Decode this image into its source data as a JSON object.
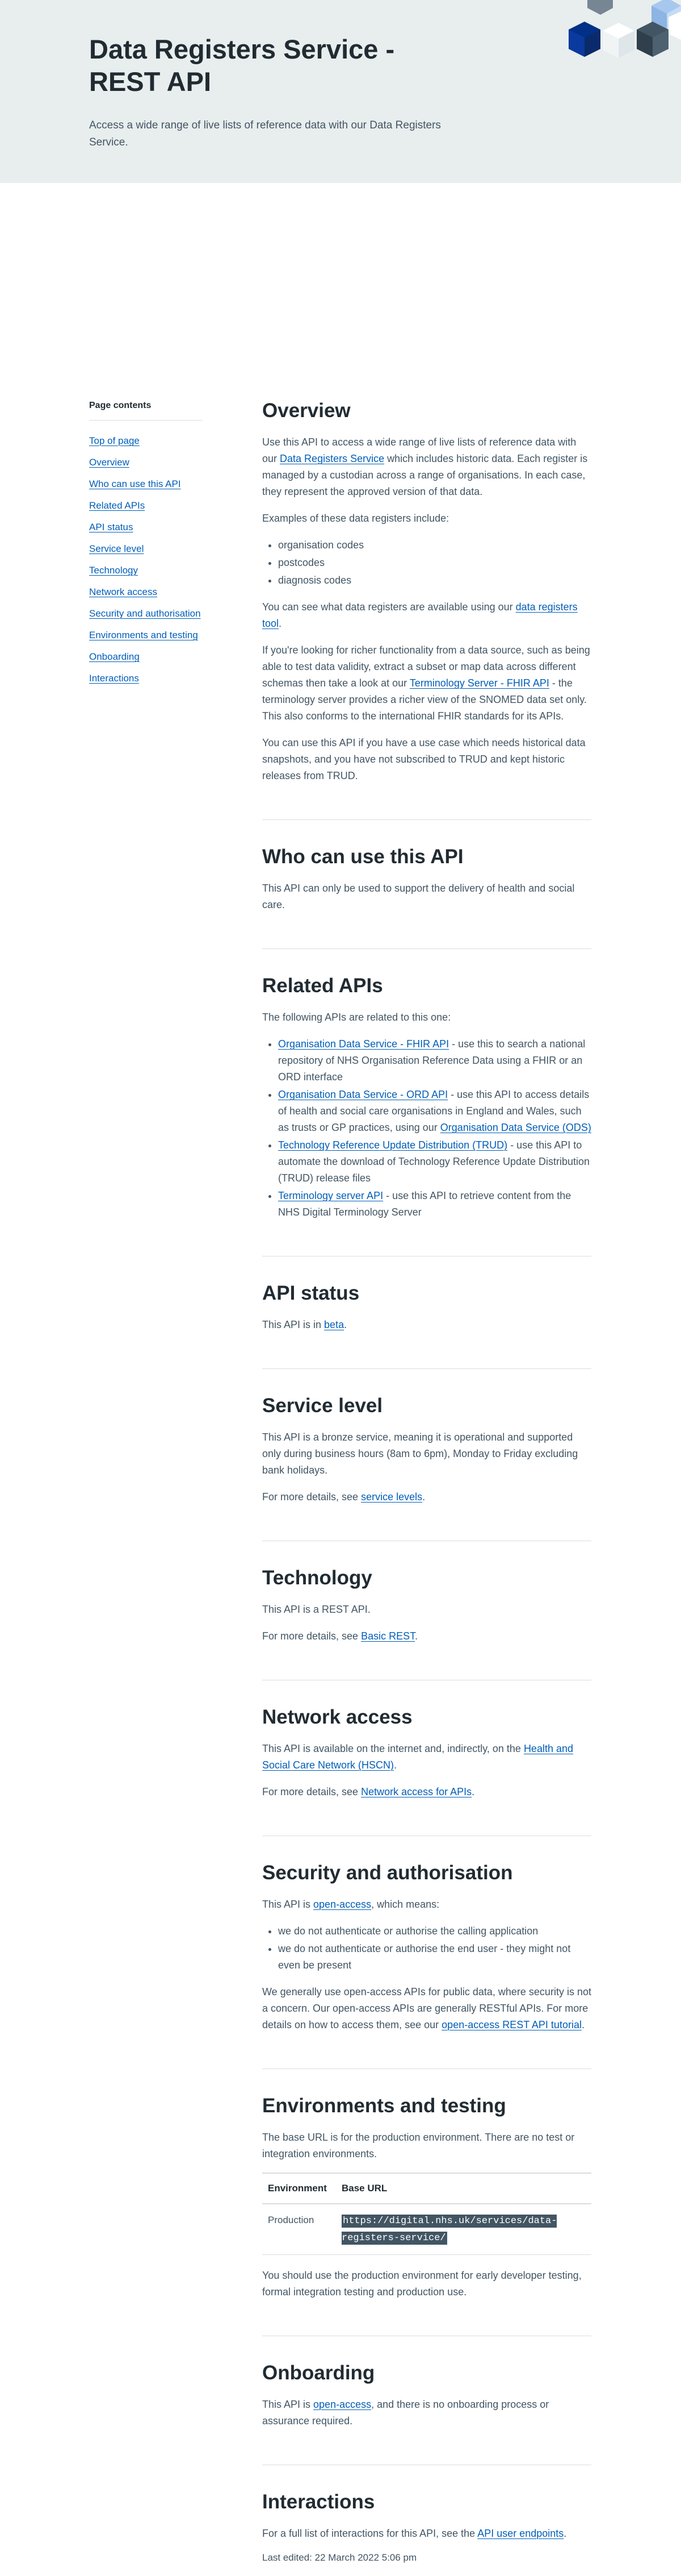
{
  "hero": {
    "title": "Data Registers Service - REST API",
    "summary": "Access a wide range of live lists of reference data with our Data Registers Service."
  },
  "nav": {
    "title": "Page contents",
    "items": [
      {
        "label": "Top of page"
      },
      {
        "label": "Overview"
      },
      {
        "label": "Who can use this API"
      },
      {
        "label": "Related APIs"
      },
      {
        "label": "API status"
      },
      {
        "label": "Service level"
      },
      {
        "label": "Technology"
      },
      {
        "label": "Network access"
      },
      {
        "label": "Security and authorisation"
      },
      {
        "label": "Environments and testing"
      },
      {
        "label": "Onboarding"
      },
      {
        "label": "Interactions"
      }
    ]
  },
  "overview": {
    "heading": "Overview",
    "p1_a": "Use this API to access a wide range of live lists of reference data with our ",
    "p1_link": "Data Registers Service",
    "p1_b": " which includes historic data. Each register is managed by a custodian across a range of organisations. In each case, they represent the approved version of that data.",
    "p2": "Examples of these data registers include:",
    "examples": [
      "organisation codes",
      "postcodes",
      "diagnosis codes"
    ],
    "p3_a": "You can see what data registers are available using our ",
    "p3_link": "data registers tool",
    "p3_b": ".",
    "p4_a": "If you're looking for richer functionality from a data source, such as being able to test data validity, extract a subset or map data across different schemas then take a look at our ",
    "p4_link": "Terminology Server - FHIR API",
    "p4_b": " - the terminology server provides a richer view of the SNOMED data set only. This also conforms to the international FHIR standards for its APIs.",
    "p5": "You can use this API if you have a use case which needs historical data snapshots, and you have not subscribed to TRUD and kept historic releases from TRUD."
  },
  "who": {
    "heading": "Who can use this API",
    "p1": "This API can only be used to support the delivery of health and social care."
  },
  "related": {
    "heading": "Related APIs",
    "intro": "The following APIs are related to this one:",
    "items": [
      {
        "link": "Organisation Data Service - FHIR API",
        "text": " - use this to search a national repository of NHS Organisation Reference Data using a FHIR or an ORD interface"
      },
      {
        "link": "Organisation Data Service - ORD API",
        "text": " - use this API to access details of health and social care organisations in England and Wales, such as trusts or GP practices, using our ",
        "link2": "Organisation Data Service (ODS)"
      },
      {
        "link": "Technology Reference Update Distribution (TRUD)",
        "text": " - use this API to automate the download of Technology Reference Update Distribution (TRUD) release files"
      },
      {
        "link": "Terminology server API",
        "text": " - use this API to retrieve content from the NHS Digital Terminology Server"
      }
    ]
  },
  "status": {
    "heading": "API status",
    "p1_a": "This API is in ",
    "p1_link": "beta",
    "p1_b": "."
  },
  "service_level": {
    "heading": "Service level",
    "p1": "This API is a bronze service, meaning it is operational and supported only during business hours (8am to 6pm), Monday to Friday excluding bank holidays.",
    "p2_a": "For more details, see ",
    "p2_link": "service levels",
    "p2_b": "."
  },
  "technology": {
    "heading": "Technology",
    "p1": "This API is a REST API.",
    "p2_a": "For more details, see ",
    "p2_link": "Basic REST",
    "p2_b": "."
  },
  "network": {
    "heading": "Network access",
    "p1_a": "This API is available on the internet and, indirectly, on the ",
    "p1_link": "Health and Social Care Network (HSCN)",
    "p1_b": ".",
    "p2_a": "For more details, see ",
    "p2_link": "Network access for APIs",
    "p2_b": "."
  },
  "security": {
    "heading": "Security and authorisation",
    "p1_a": "This API is ",
    "p1_link": "open-access",
    "p1_b": ", which means:",
    "points": [
      "we do not authenticate or authorise the calling application",
      "we do not authenticate or authorise the end user - they might not even be present"
    ],
    "p2_a": "We generally use open-access APIs for public data, where security is not a concern. Our open-access APIs are generally RESTful APIs. For more details on how to access them, see our ",
    "p2_link": "open-access REST API tutorial",
    "p2_b": "."
  },
  "environments": {
    "heading": "Environments and testing",
    "p1": "The base URL is for the production environment.  There are no test or integration environments.",
    "col_env": "Environment",
    "col_url": "Base URL",
    "rows": [
      {
        "env": "Production",
        "url": "https://digital.nhs.uk/services/data-registers-service/"
      }
    ],
    "p2": "You should use the production environment for early developer testing, formal integration testing and production use."
  },
  "onboarding": {
    "heading": "Onboarding",
    "p1_a": "This API is ",
    "p1_link": "open-access",
    "p1_b": ", and there is no onboarding process or assurance required."
  },
  "interactions": {
    "heading": "Interactions",
    "p1_a": "For a full list of interactions for this API, see the ",
    "p1_link": "API user endpoints",
    "p1_b": "."
  },
  "last_edited": "Last edited: 22 March 2022 5:06 pm",
  "colors": {
    "hero_bg": "#e8edee",
    "link": "#005eb8",
    "text": "#212b32",
    "secondary_text": "#425563",
    "divider": "#d8dde0"
  }
}
